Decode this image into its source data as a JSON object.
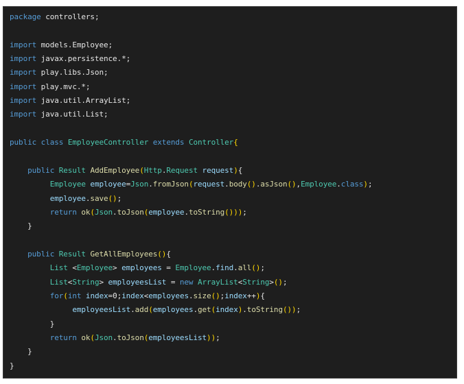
{
  "editor": {
    "theme": "dark",
    "colors": {
      "background": "#1e1e1e",
      "keyword": "#569cd6",
      "type": "#4ec9b0",
      "function": "#dcdcaa",
      "variable": "#9cdcfe",
      "text": "#e6e6e6"
    },
    "lines": [
      [
        [
          "kw",
          "package"
        ],
        [
          "pl",
          " controllers;"
        ]
      ],
      [],
      [
        [
          "kw",
          "import"
        ],
        [
          "pl",
          " models.Employee;"
        ]
      ],
      [
        [
          "kw",
          "import"
        ],
        [
          "pl",
          " javax.persistence.*;"
        ]
      ],
      [
        [
          "kw",
          "import"
        ],
        [
          "pl",
          " play.libs.Json;"
        ]
      ],
      [
        [
          "kw",
          "import"
        ],
        [
          "pl",
          " play.mvc.*;"
        ]
      ],
      [
        [
          "kw",
          "import"
        ],
        [
          "pl",
          " java.util.ArrayList;"
        ]
      ],
      [
        [
          "kw",
          "import"
        ],
        [
          "pl",
          " java.util.List;"
        ]
      ],
      [],
      [
        [
          "kw",
          "public"
        ],
        [
          "pl",
          " "
        ],
        [
          "kw",
          "class"
        ],
        [
          "pl",
          " "
        ],
        [
          "ty",
          "EmployeeController"
        ],
        [
          "pl",
          " "
        ],
        [
          "kw",
          "extends"
        ],
        [
          "pl",
          " "
        ],
        [
          "ty",
          "Controller"
        ],
        [
          "br",
          "{"
        ]
      ],
      [],
      [
        [
          "pl",
          "    "
        ],
        [
          "kw",
          "public"
        ],
        [
          "pl",
          " "
        ],
        [
          "ty",
          "Result"
        ],
        [
          "pl",
          " "
        ],
        [
          "fn",
          "AddEmployee"
        ],
        [
          "br",
          "("
        ],
        [
          "ty",
          "Http"
        ],
        [
          "pl",
          "."
        ],
        [
          "ty",
          "Request"
        ],
        [
          "pl",
          " "
        ],
        [
          "vr",
          "request"
        ],
        [
          "br",
          ")"
        ],
        [
          "pl",
          "{"
        ]
      ],
      [
        [
          "pl",
          "         "
        ],
        [
          "ty",
          "Employee"
        ],
        [
          "pl",
          " "
        ],
        [
          "vr",
          "employee"
        ],
        [
          "pl",
          "="
        ],
        [
          "ty",
          "Json"
        ],
        [
          "pl",
          "."
        ],
        [
          "fn",
          "fromJson"
        ],
        [
          "br",
          "("
        ],
        [
          "vr",
          "request"
        ],
        [
          "pl",
          "."
        ],
        [
          "fn",
          "body"
        ],
        [
          "br",
          "()"
        ],
        [
          "pl",
          "."
        ],
        [
          "fn",
          "asJson"
        ],
        [
          "br",
          "()"
        ],
        [
          "pl",
          ","
        ],
        [
          "ty",
          "Employee"
        ],
        [
          "pl",
          "."
        ],
        [
          "kw",
          "class"
        ],
        [
          "br",
          ")"
        ],
        [
          "pl",
          ";"
        ]
      ],
      [
        [
          "pl",
          "         "
        ],
        [
          "vr",
          "employee"
        ],
        [
          "pl",
          "."
        ],
        [
          "fn",
          "save"
        ],
        [
          "br",
          "()"
        ],
        [
          "pl",
          ";"
        ]
      ],
      [
        [
          "pl",
          "         "
        ],
        [
          "kw",
          "return"
        ],
        [
          "pl",
          " "
        ],
        [
          "fn",
          "ok"
        ],
        [
          "br",
          "("
        ],
        [
          "ty",
          "Json"
        ],
        [
          "pl",
          "."
        ],
        [
          "fn",
          "toJson"
        ],
        [
          "br",
          "("
        ],
        [
          "vr",
          "employee"
        ],
        [
          "pl",
          "."
        ],
        [
          "fn",
          "toString"
        ],
        [
          "br",
          "()))"
        ],
        [
          "pl",
          ";"
        ]
      ],
      [
        [
          "pl",
          "    }"
        ]
      ],
      [],
      [
        [
          "pl",
          "    "
        ],
        [
          "kw",
          "public"
        ],
        [
          "pl",
          " "
        ],
        [
          "ty",
          "Result"
        ],
        [
          "pl",
          " "
        ],
        [
          "fn",
          "GetAllEmployees"
        ],
        [
          "br",
          "()"
        ],
        [
          "pl",
          "{"
        ]
      ],
      [
        [
          "pl",
          "         "
        ],
        [
          "ty",
          "List"
        ],
        [
          "pl",
          " <"
        ],
        [
          "ty",
          "Employee"
        ],
        [
          "pl",
          "> "
        ],
        [
          "vr",
          "employees"
        ],
        [
          "pl",
          " = "
        ],
        [
          "ty",
          "Employee"
        ],
        [
          "pl",
          "."
        ],
        [
          "vr",
          "find"
        ],
        [
          "pl",
          "."
        ],
        [
          "fn",
          "all"
        ],
        [
          "br",
          "()"
        ],
        [
          "pl",
          ";"
        ]
      ],
      [
        [
          "pl",
          "         "
        ],
        [
          "ty",
          "List"
        ],
        [
          "pl",
          "<"
        ],
        [
          "ty",
          "String"
        ],
        [
          "pl",
          "> "
        ],
        [
          "vr",
          "employeesList"
        ],
        [
          "pl",
          " = "
        ],
        [
          "kw",
          "new"
        ],
        [
          "pl",
          " "
        ],
        [
          "ty",
          "ArrayList"
        ],
        [
          "pl",
          "<"
        ],
        [
          "ty",
          "String"
        ],
        [
          "pl",
          ">"
        ],
        [
          "br",
          "()"
        ],
        [
          "pl",
          ";"
        ]
      ],
      [
        [
          "pl",
          "         "
        ],
        [
          "kw",
          "for"
        ],
        [
          "br",
          "("
        ],
        [
          "kw",
          "int"
        ],
        [
          "pl",
          " "
        ],
        [
          "vr",
          "index"
        ],
        [
          "pl",
          "=0;"
        ],
        [
          "vr",
          "index"
        ],
        [
          "pl",
          "<"
        ],
        [
          "vr",
          "employees"
        ],
        [
          "pl",
          "."
        ],
        [
          "fn",
          "size"
        ],
        [
          "br",
          "()"
        ],
        [
          "pl",
          ";"
        ],
        [
          "vr",
          "index"
        ],
        [
          "pl",
          "++"
        ],
        [
          "br",
          ")"
        ],
        [
          "pl",
          "{"
        ]
      ],
      [
        [
          "pl",
          "              "
        ],
        [
          "vr",
          "employeesList"
        ],
        [
          "pl",
          "."
        ],
        [
          "fn",
          "add"
        ],
        [
          "br",
          "("
        ],
        [
          "vr",
          "employees"
        ],
        [
          "pl",
          "."
        ],
        [
          "fn",
          "get"
        ],
        [
          "br",
          "("
        ],
        [
          "vr",
          "index"
        ],
        [
          "br",
          ")"
        ],
        [
          "pl",
          "."
        ],
        [
          "fn",
          "toString"
        ],
        [
          "br",
          "())"
        ],
        [
          "pl",
          ";"
        ]
      ],
      [
        [
          "pl",
          "         }"
        ]
      ],
      [
        [
          "pl",
          "         "
        ],
        [
          "kw",
          "return"
        ],
        [
          "pl",
          " "
        ],
        [
          "fn",
          "ok"
        ],
        [
          "br",
          "("
        ],
        [
          "ty",
          "Json"
        ],
        [
          "pl",
          "."
        ],
        [
          "fn",
          "toJson"
        ],
        [
          "br",
          "("
        ],
        [
          "vr",
          "employeesList"
        ],
        [
          "br",
          "))"
        ],
        [
          "pl",
          ";"
        ]
      ],
      [
        [
          "pl",
          "    }"
        ]
      ],
      [
        [
          "pl",
          "}"
        ]
      ]
    ]
  }
}
